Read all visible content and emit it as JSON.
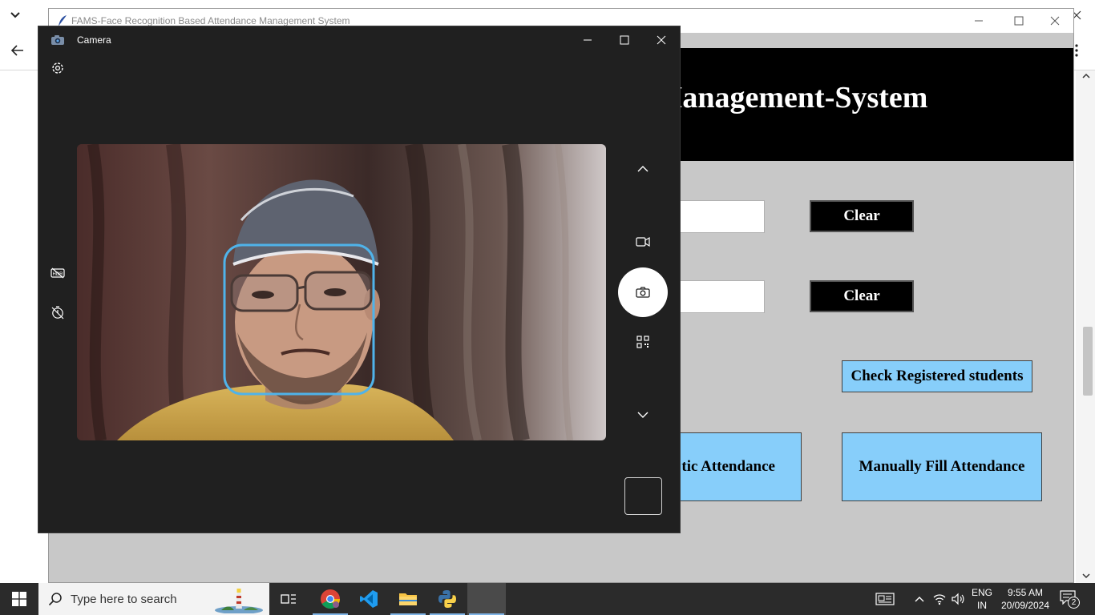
{
  "app_window": {
    "title": "FAMS-Face Recognition Based Attendance Management System",
    "header_title_visible": "e-Management-System",
    "clear_button_1": "Clear",
    "clear_button_2": "Clear",
    "check_registered_button": "Check Registered students",
    "automatic_attendance_button_visible": "tic Attendance",
    "manual_attendance_button": "Manually Fill Attendance",
    "header_color": "#000000",
    "button_accent_color": "#87cefa"
  },
  "camera_window": {
    "title": "Camera",
    "icons": {
      "settings": "gear-icon",
      "hdr": "hdr-off-icon",
      "timer": "timer-off-icon",
      "up": "chevron-up-icon",
      "video": "video-mode-icon",
      "photo": "camera-shutter-icon",
      "qr": "qr-code-icon",
      "down": "chevron-down-icon"
    },
    "face_box_color": "#4fb3ea"
  },
  "taskbar": {
    "search_placeholder": "Type here to search",
    "language_line1": "ENG",
    "language_line2": "IN",
    "time": "9:55 AM",
    "date": "20/09/2024",
    "notification_count": "2",
    "pinned_apps": [
      "task-view",
      "chrome",
      "vs-code",
      "file-explorer",
      "python"
    ]
  }
}
